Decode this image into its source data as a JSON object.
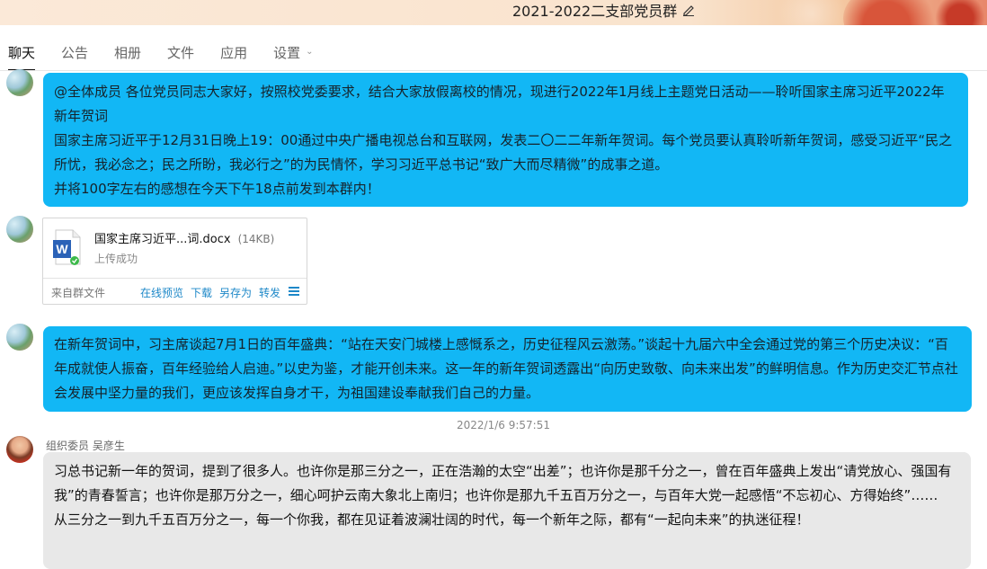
{
  "window": {
    "title": "2021-2022二支部党员群"
  },
  "tabs": [
    {
      "label": "聊天"
    },
    {
      "label": "公告"
    },
    {
      "label": "相册"
    },
    {
      "label": "文件"
    },
    {
      "label": "应用"
    },
    {
      "label": "设置"
    }
  ],
  "messages": {
    "m1": {
      "lines": [
        "@全体成员 各位党员同志大家好，按照校党委要求，结合大家放假离校的情况，现进行2022年1月线上主题党日活动——聆听国家主席习近平2022年新年贺词",
        " 国家主席习近平于12月31日晚上19：00通过中央广播电视总台和互联网，发表二〇二二年新年贺词。每个党员要认真聆听新年贺词，感受习近平“民之所忧，我必念之；民之所盼，我必行之”的为民情怀，学习习近平总书记“致广大而尽精微”的成事之道。",
        "并将100字左右的感想在今天下午18点前发到本群内！"
      ]
    },
    "file": {
      "name": "国家主席习近平...词.docx",
      "size": "(14KB)",
      "status": "上传成功",
      "source": "来自群文件",
      "actions": [
        "在线预览",
        "下载",
        "另存为",
        "转发"
      ]
    },
    "m2": {
      "text": "在新年贺词中，习主席谈起7月1日的百年盛典：“站在天安门城楼上感慨系之，历史征程风云激荡。”谈起十九届六中全会通过党的第三个历史决议：“百年成就使人振奋，百年经验给人启迪。”以史为鉴，才能开创未来。这一年的新年贺词透露出“向历史致敬、向未来出发”的鲜明信息。作为历史交汇节点社会发展中坚力量的我们，更应该发挥自身才干，为祖国建设奉献我们自己的力量。"
    },
    "timestamp": "2022/1/6 9:57:51",
    "m3": {
      "sender": "组织委员 吴彦生",
      "lines": [
        "习总书记新一年的贺词，提到了很多人。也许你是那三分之一，正在浩瀚的太空“出差”；也许你是那千分之一，曾在百年盛典上发出“请党放心、强国有我”的青春誓言；也许你是那万分之一，细心呵护云南大象北上南归；也许你是那九千五百万分之一，与百年大党一起感悟“不忘初心、方得始终”……",
        "从三分之一到九千五百万分之一，每一个你我，都在见证着波澜壮阔的时代，每一个新年之际，都有“一起向未来”的执迷征程！"
      ]
    }
  },
  "colors": {
    "bubble_blue": "#12b7f5",
    "bubble_gray": "#e8e8e8",
    "link": "#1e88c8"
  },
  "icons": [
    "edit-icon",
    "chevron-down-icon",
    "word-doc-icon",
    "check-icon",
    "menu-icon"
  ]
}
